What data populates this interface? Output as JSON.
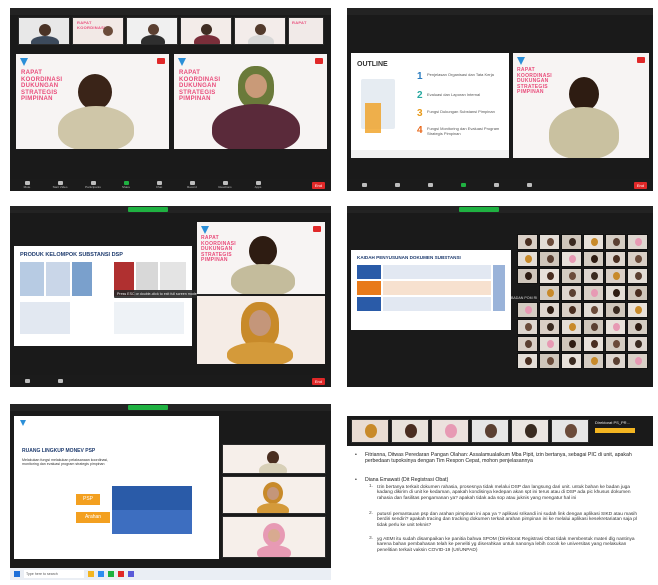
{
  "panel1": {
    "toolbar": [
      "Mute",
      "Start Video",
      "Participants",
      "Share",
      "Chat",
      "Record",
      "Reactions",
      "Apps"
    ],
    "end": "End",
    "slide_title": "RAPAT KOORDINASI DUKUNGAN STRATEGIS PIMPINAN",
    "slide_sub": "Jakarta, 21 - 22 September 2021"
  },
  "panel2": {
    "outline_title": "OUTLINE",
    "items": [
      {
        "n": "1",
        "text": "Penjelasan Organisasi dan Tata Kerja"
      },
      {
        "n": "2",
        "text": "Evaluasi dan Laporan Internal"
      },
      {
        "n": "3",
        "text": "Fungsi Dukungan Substansi Pimpinan"
      },
      {
        "n": "4",
        "text": "Fungsi Monitoring dan Evaluasi Program Strategis Pimpinan"
      }
    ],
    "slide_title": "RAPAT KOORDINASI DUKUNGAN STRATEGIS PIMPINAN"
  },
  "panel3": {
    "slide_heading": "PRODUK KELOMPOK SUBSTANSI DSP",
    "tooltip": "Press ESC or double-click to exit full screen mode",
    "slide_title": "RAPAT KOORDINASI DUKUNGAN STRATEGIS PIMPINAN"
  },
  "panel4": {
    "slide_heading": "KAIDAH PENYUSUNAN DOKUMEN SUBSTANSI",
    "label": "BADAN POM RI"
  },
  "panel5": {
    "slide_heading": "RUANG LINGKUP MONEV PSP",
    "slide_body": "Melakukan fungsi melakukan pelaksanaan koordinasi, monitoring dan evaluasi program strategis pimpinan",
    "boxes": [
      "PSP",
      "Arahan"
    ],
    "taskbar_search": "Type here to search"
  },
  "panel6": {
    "speaker": "Direktorat PS_PR...",
    "bullets": [
      {
        "text": "Fitrianna, Ditwas Peredaran Pangan Olahan: Assalamualaikum Mba Pipit, izin bertanya, sebagai PIC di unit, apakah perbedaan tupoksinya dengan Tim Respon Cepat, mohon penjelasannya"
      },
      {
        "text": "Diana Emawati (Dit Registrasi Obat)"
      }
    ],
    "numbered": [
      {
        "n": "1.",
        "text": "Izin bertanya terkait dokumen rahasia, prosesnya tidak melalui DSP dan langsung dari unit. untuk bahan ke badan juga kadang dikirim di unit ke kedaman, apakah kondisinya kedepan akan spt ini terus atau di DSP ada pic khusus dokumen rahasia dan fasilitas pengamanan ya? apakah tidak ada sop atau juknis yang mengatur hal ini"
      },
      {
        "n": "2.",
        "text": "putusri pemantauan psp dan arahan pimpinan ini apa ya ? aplikasi srikandi ini sudah link dengan aplikasi SIKD atau masih berdiri sendiri? apakah tracing dan tracking dokumen terkait arahan pimpinan ini ke melalui aplikasi kesekretariatan saja pl tidak perlu ke unit teknis?"
      },
      {
        "n": "3.",
        "text": "yg AEMI itu sudah disampaikan ke panitia bahwa SPOM (Direktorat Registrasi Obat tidak membentuk materi dlg nantinya karena bahan pembahasan telah ke peneliti yg diserahkan untuk nanonya lebih cocok ke universitas yang melakukan penelitian terkait vaksin COVID-19 (UI/UNPAD)"
      }
    ]
  }
}
